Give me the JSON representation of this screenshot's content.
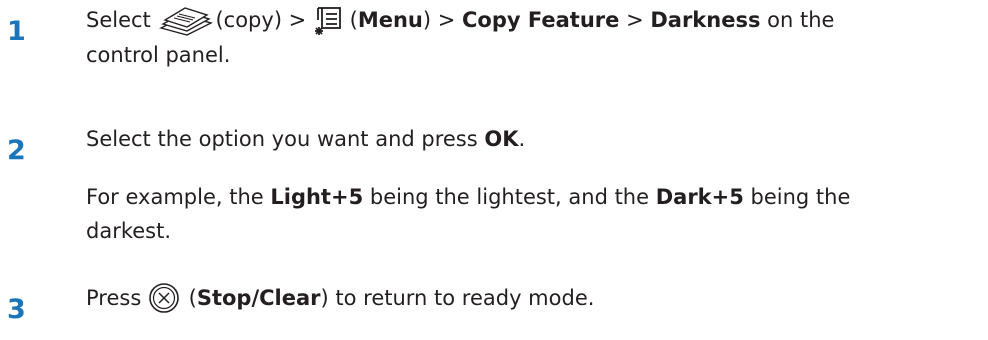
{
  "steps": [
    {
      "number": "1",
      "prefix": "Select ",
      "copy_icon": "copy-icon",
      "copy_paren": "(copy) > ",
      "menu_icon": "menu-icon",
      "menu_open": " (",
      "menu_label": "Menu",
      "menu_close": ") > ",
      "copy_feature": "Copy Feature",
      "sep": " > ",
      "darkness": "Darkness",
      "suffix": " on the",
      "line2": "control panel."
    },
    {
      "number": "2",
      "prefix": "Select the option you want and press ",
      "ok": "OK",
      "suffix": ".",
      "example_prefix": "For example, the ",
      "light": "Light+5",
      "example_mid": " being the lightest, and the ",
      "dark": "Dark+5",
      "example_suffix": " being the",
      "example_line2": "darkest."
    },
    {
      "number": "3",
      "prefix": "Press ",
      "stop_icon": "stop-clear-icon",
      "open": " (",
      "stop_label": "Stop/Clear",
      "suffix": ") to return to ready mode."
    }
  ],
  "colors": {
    "step_number": "#1b75bb",
    "text": "#231f20"
  }
}
